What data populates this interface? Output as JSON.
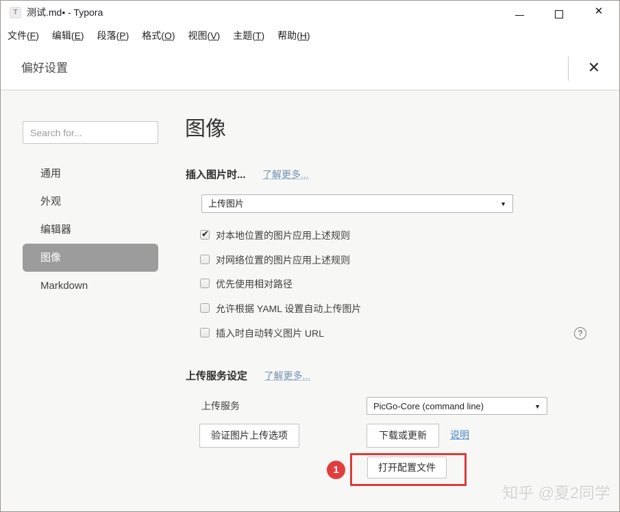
{
  "window": {
    "title": "测试.md• - Typora",
    "app_icon_letter": "T"
  },
  "icons": {
    "close": "✕",
    "dropdown_arrow": "▼",
    "check": "✔",
    "help": "?"
  },
  "menu": {
    "items": [
      {
        "pre": "文件(",
        "key": "F",
        "post": ")"
      },
      {
        "pre": "编辑(",
        "key": "E",
        "post": ")"
      },
      {
        "pre": "段落(",
        "key": "P",
        "post": ")"
      },
      {
        "pre": "格式(",
        "key": "O",
        "post": ")"
      },
      {
        "pre": "视图(",
        "key": "V",
        "post": ")"
      },
      {
        "pre": "主题(",
        "key": "T",
        "post": ")"
      },
      {
        "pre": "帮助(",
        "key": "H",
        "post": ")"
      }
    ]
  },
  "prefs_header": {
    "title": "偏好设置"
  },
  "sidebar": {
    "search_placeholder": "Search for...",
    "items": [
      {
        "label": "通用"
      },
      {
        "label": "外观"
      },
      {
        "label": "编辑器"
      },
      {
        "label": "图像"
      },
      {
        "label": "Markdown"
      }
    ],
    "selected_item": "图像"
  },
  "main": {
    "heading": "图像",
    "insert_section": {
      "label": "插入图片时...",
      "learn_more": "了解更多...",
      "dropdown_value": "上传图片"
    },
    "checkboxes": [
      {
        "label": "对本地位置的图片应用上述规则",
        "checked": true
      },
      {
        "label": "对网络位置的图片应用上述规则",
        "checked": false
      },
      {
        "label": "优先使用相对路径",
        "checked": false
      },
      {
        "label": "允许根据 YAML 设置自动上传图片",
        "checked": false
      },
      {
        "label": "插入时自动转义图片 URL",
        "checked": false
      }
    ],
    "upload_section": {
      "title": "上传服务设定",
      "learn_more": "了解更多...",
      "service_label": "上传服务",
      "service_value": "PicGo-Core (command line)",
      "validate_button": "验证图片上传选项",
      "download_button": "下载或更新",
      "docs_link": "说明",
      "open_config_button": "打开配置文件"
    },
    "annotation_badge": "1"
  },
  "watermark": "知乎 @夏2同学",
  "colors": {
    "accent_red": "#da3b3b",
    "link_muted": "#7192af",
    "link_blue": "#4a86c5",
    "selected_nav_bg": "#9c9c9c",
    "content_bg": "#f7f7f6"
  }
}
